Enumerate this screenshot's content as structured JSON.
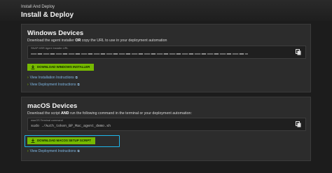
{
  "header": {
    "breadcrumb": "Install And Deploy",
    "title": "Install & Deploy"
  },
  "windows": {
    "title": "Windows Devices",
    "description_pre": "Download the agent installer ",
    "description_bold": "OR",
    "description_post": " copy the URL to use in your deployment automation",
    "field_label": "SNAP MSR Agent Installer URL",
    "download_button": "DOWNLOAD WINDOWS INSTALLER",
    "links": [
      {
        "label": "View Installation Instructions"
      },
      {
        "label": "View Deployment Instructions"
      }
    ]
  },
  "macos": {
    "title": "macOS Devices",
    "description_pre": "Download the script ",
    "description_bold": "AND",
    "description_post": " run the following command in the terminal or your deployment automation:",
    "field_label": "macOS Terminal command",
    "field_value": "sudo ./Auth_token_BP_Mac_agent_demo.sh",
    "download_button": "DOWNLOAD MACOS SETUP SCRIPT",
    "links": [
      {
        "label": "View Deployment Instructions"
      }
    ]
  },
  "colors": {
    "accent": "#76b900",
    "link": "#7fb8e6",
    "highlight": "#1fb6ea",
    "panel": "#2c2c2c",
    "background": "#1c1c1c"
  },
  "icons": [
    "copy-icon",
    "download-icon",
    "chevron-right-icon",
    "external-link-icon"
  ]
}
